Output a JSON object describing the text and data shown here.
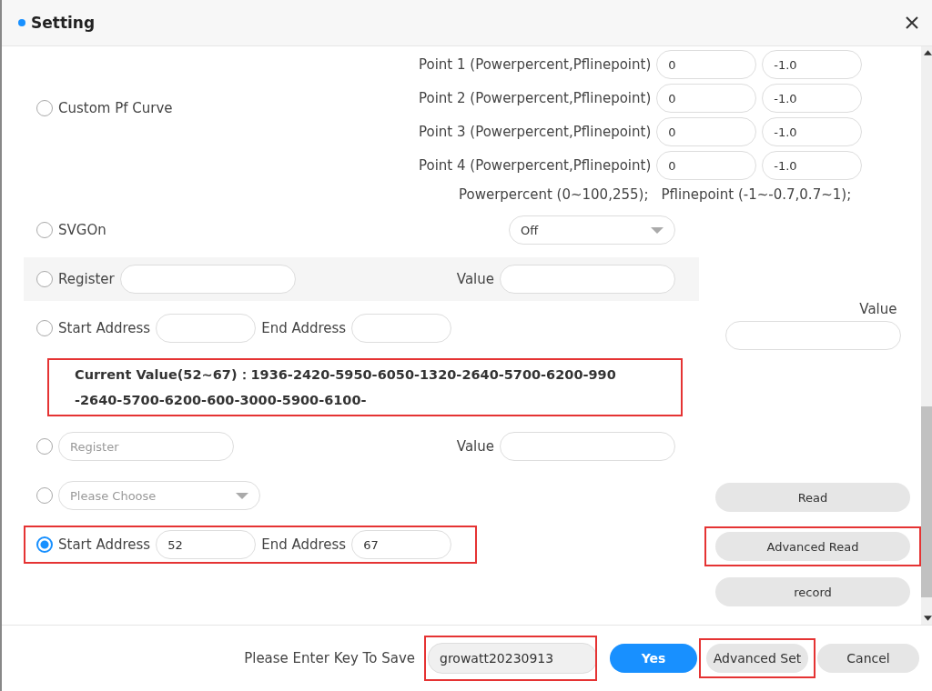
{
  "window": {
    "title": "Setting"
  },
  "pf_curve": {
    "option": {
      "label": "Custom Pf Curve",
      "selected": false
    },
    "points": [
      {
        "label": "Point 1 (Powerpercent,Pflinepoint)",
        "power": "0",
        "pfline": "-1.0"
      },
      {
        "label": "Point 2 (Powerpercent,Pflinepoint)",
        "power": "0",
        "pfline": "-1.0"
      },
      {
        "label": "Point 3 (Powerpercent,Pflinepoint)",
        "power": "0",
        "pfline": "-1.0"
      },
      {
        "label": "Point 4 (Powerpercent,Pflinepoint)",
        "power": "0",
        "pfline": "-1.0"
      }
    ],
    "note_power": "Powerpercent (0~100,255);",
    "note_pfline": "Pflinepoint (-1~-0.7,0.7~1);"
  },
  "rows": [
    {
      "kind": "select",
      "label": "SVGOn",
      "selected": false,
      "value": "Off"
    },
    {
      "kind": "register",
      "label": "Register",
      "selected": false,
      "value_label": "Value",
      "shaded": true
    },
    {
      "kind": "range",
      "start_label": "Start Address",
      "end_label": "End Address",
      "selected": false,
      "side": {
        "kind": "field",
        "label": "Value"
      }
    },
    {
      "kind": "readout",
      "lines": [
        "Current Value(52~67)：1936-2420-5950-6050-1320-2640-5700-6200-990",
        "-2640-5700-6200-600-3000-5900-6100-"
      ],
      "highlighted": true
    },
    {
      "kind": "register",
      "placeholder": "Register",
      "selected": false,
      "value_label": "Value"
    },
    {
      "kind": "select",
      "placeholder": "Please Choose",
      "selected": false,
      "side": {
        "kind": "button",
        "label": "Read"
      }
    },
    {
      "kind": "range",
      "start_label": "Start Address",
      "end_label": "End Address",
      "start": "52",
      "end": "67",
      "selected": true,
      "highlighted": true,
      "side": {
        "kind": "button",
        "label": "Advanced Read",
        "highlighted": true
      }
    },
    {
      "kind": "side",
      "side": {
        "kind": "button",
        "label": "record"
      }
    }
  ],
  "footer": {
    "prompt": "Please Enter Key To Save",
    "key": "growatt20230913",
    "key_highlighted": true,
    "buttons": [
      {
        "label": "Yes",
        "kind": "primary"
      },
      {
        "label": "Advanced Set",
        "kind": "default",
        "highlighted": true
      },
      {
        "label": "Cancel",
        "kind": "default"
      }
    ]
  }
}
